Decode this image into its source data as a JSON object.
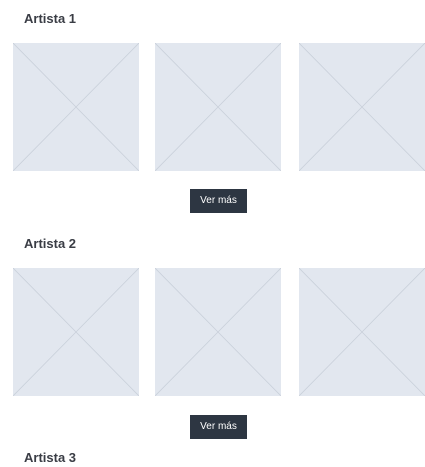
{
  "sections": [
    {
      "title": "Artista 1",
      "images": [
        "image-placeholder",
        "image-placeholder",
        "image-placeholder"
      ],
      "button_label": "Ver más"
    },
    {
      "title": "Artista 2",
      "images": [
        "image-placeholder",
        "image-placeholder",
        "image-placeholder"
      ],
      "button_label": "Ver más"
    },
    {
      "title": "Artista 3"
    }
  ],
  "colors": {
    "placeholder_fill": "#e2e7ef",
    "placeholder_lines": "#c9d0da",
    "button_background": "#2d3642",
    "button_text": "#ffffff",
    "heading_text": "#3a3d45"
  }
}
